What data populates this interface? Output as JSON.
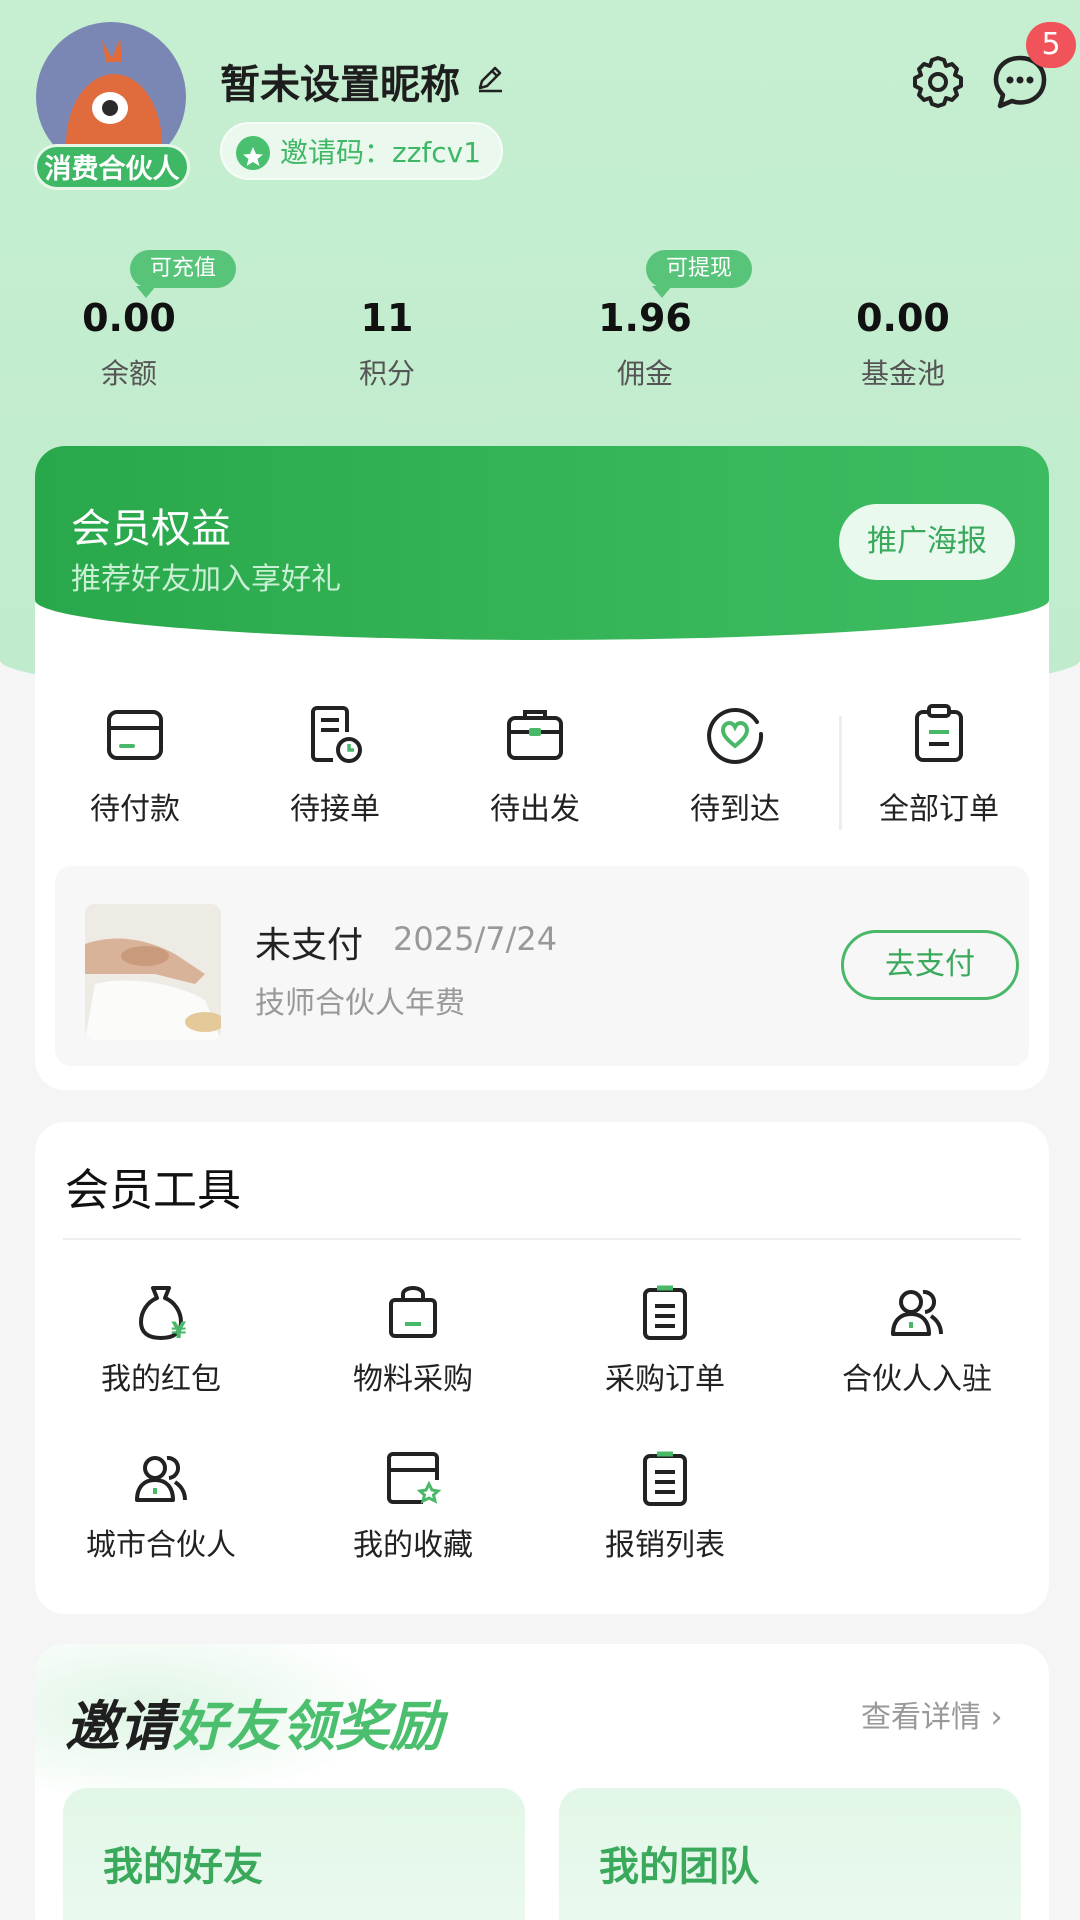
{
  "header": {
    "nickname": "暂未设置昵称",
    "role_badge": "消费合伙人",
    "invite_label": "邀请码：zzfcv1",
    "message_count": "5"
  },
  "stats": [
    {
      "value": "0.00",
      "label": "余额",
      "tip": "可充值"
    },
    {
      "value": "11",
      "label": "积分"
    },
    {
      "value": "1.96",
      "label": "佣金",
      "tip": "可提现"
    },
    {
      "value": "0.00",
      "label": "基金池"
    }
  ],
  "member": {
    "title": "会员权益",
    "subtitle": "推荐好友加入享好礼",
    "poster_button": "推广海报"
  },
  "orders": [
    {
      "label": "待付款",
      "icon": "wallet-card-icon"
    },
    {
      "label": "待接单",
      "icon": "document-clock-icon"
    },
    {
      "label": "待出发",
      "icon": "briefcase-icon"
    },
    {
      "label": "待到达",
      "icon": "heart-circle-icon"
    },
    {
      "label": "全部订单",
      "icon": "clipboard-icon"
    }
  ],
  "pending_order": {
    "status": "未支付",
    "date": "2025/7/24",
    "description": "技师合伙人年费",
    "pay_button": "去支付"
  },
  "tools": {
    "title": "会员工具",
    "items": [
      {
        "label": "我的红包",
        "icon": "money-bag-icon"
      },
      {
        "label": "物料采购",
        "icon": "shopping-bag-icon"
      },
      {
        "label": "采购订单",
        "icon": "list-clipboard-icon"
      },
      {
        "label": "合伙人入驻",
        "icon": "people-icon"
      },
      {
        "label": "城市合伙人",
        "icon": "people-icon"
      },
      {
        "label": "我的收藏",
        "icon": "star-card-icon"
      },
      {
        "label": "报销列表",
        "icon": "list-clipboard-icon"
      }
    ]
  },
  "invite": {
    "title_dark": "邀请",
    "title_green": "好友领奖励",
    "more_link": "查看详情 ›",
    "cards": [
      "我的好友",
      "我的团队"
    ]
  },
  "colors": {
    "brand_green": "#3fb866",
    "badge_red": "#f0535a",
    "hero_bg": "#c6efd1"
  }
}
